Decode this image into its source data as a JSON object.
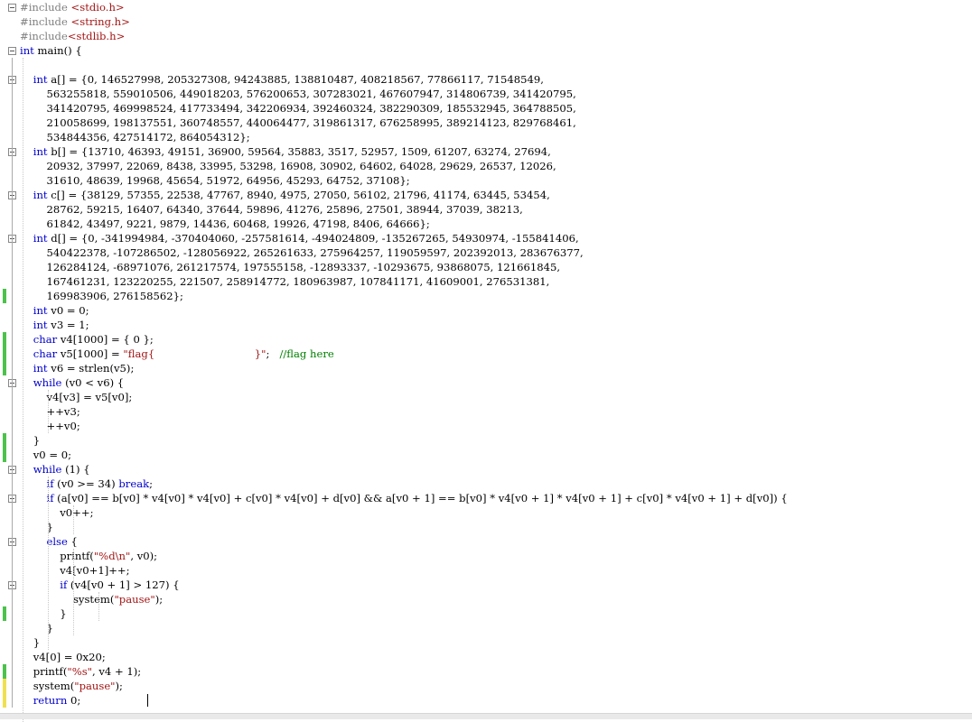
{
  "editor": {
    "lines": [
      {
        "text": "#include <stdio.h>",
        "kind": "include",
        "fold": true,
        "bar": null
      },
      {
        "text": "#include <string.h>",
        "kind": "include",
        "fold": false,
        "bar": null
      },
      {
        "text": "#include<stdlib.h>",
        "kind": "include",
        "fold": false,
        "bar": null
      },
      {
        "text": "int main() {",
        "kind": "code",
        "fold": true,
        "bar": null
      },
      {
        "text": "",
        "kind": "code",
        "fold": false,
        "bar": null
      },
      {
        "text": "    int a[] = {0, 146527998, 205327308, 94243885, 138810487, 408218567, 77866117, 71548549,",
        "kind": "code",
        "fold": true,
        "bar": null
      },
      {
        "text": "        563255818, 559010506, 449018203, 576200653, 307283021, 467607947, 314806739, 341420795,",
        "kind": "code",
        "fold": false,
        "bar": null
      },
      {
        "text": "        341420795, 469998524, 417733494, 342206934, 392460324, 382290309, 185532945, 364788505,",
        "kind": "code",
        "fold": false,
        "bar": null
      },
      {
        "text": "        210058699, 198137551, 360748557, 440064477, 319861317, 676258995, 389214123, 829768461,",
        "kind": "code",
        "fold": false,
        "bar": null
      },
      {
        "text": "        534844356, 427514172, 864054312};",
        "kind": "code",
        "fold": false,
        "bar": null
      },
      {
        "text": "    int b[] = {13710, 46393, 49151, 36900, 59564, 35883, 3517, 52957, 1509, 61207, 63274, 27694,",
        "kind": "code",
        "fold": true,
        "bar": null
      },
      {
        "text": "        20932, 37997, 22069, 8438, 33995, 53298, 16908, 30902, 64602, 64028, 29629, 26537, 12026,",
        "kind": "code",
        "fold": false,
        "bar": null
      },
      {
        "text": "        31610, 48639, 19968, 45654, 51972, 64956, 45293, 64752, 37108};",
        "kind": "code",
        "fold": false,
        "bar": null
      },
      {
        "text": "    int c[] = {38129, 57355, 22538, 47767, 8940, 4975, 27050, 56102, 21796, 41174, 63445, 53454,",
        "kind": "code",
        "fold": true,
        "bar": null
      },
      {
        "text": "        28762, 59215, 16407, 64340, 37644, 59896, 41276, 25896, 27501, 38944, 37039, 38213,",
        "kind": "code",
        "fold": false,
        "bar": null
      },
      {
        "text": "        61842, 43497, 9221, 9879, 14436, 60468, 19926, 47198, 8406, 64666};",
        "kind": "code",
        "fold": false,
        "bar": null
      },
      {
        "text": "    int d[] = {0, -341994984, -370404060, -257581614, -494024809, -135267265, 54930974, -155841406,",
        "kind": "code",
        "fold": true,
        "bar": null
      },
      {
        "text": "        540422378, -107286502, -128056922, 265261633, 275964257, 119059597, 202392013, 283676377,",
        "kind": "code",
        "fold": false,
        "bar": null
      },
      {
        "text": "        126284124, -68971076, 261217574, 197555158, -12893337, -10293675, 93868075, 121661845,",
        "kind": "code",
        "fold": false,
        "bar": null
      },
      {
        "text": "        167461231, 123220255, 221507, 258914772, 180963987, 107841171, 41609001, 276531381,",
        "kind": "code",
        "fold": false,
        "bar": null
      },
      {
        "text": "        169983906, 276158562};",
        "kind": "code",
        "fold": false,
        "bar": "green"
      },
      {
        "text": "    int v0 = 0;",
        "kind": "code",
        "fold": false,
        "bar": null
      },
      {
        "text": "    int v3 = 1;",
        "kind": "code",
        "fold": false,
        "bar": null
      },
      {
        "text": "    char v4[1000] = { 0 };",
        "kind": "code",
        "fold": false,
        "bar": "green"
      },
      {
        "text": "    char v5[1000] = \"flag{                              }\";   //flag here",
        "kind": "code",
        "fold": false,
        "bar": "green"
      },
      {
        "text": "    int v6 = strlen(v5);",
        "kind": "code",
        "fold": false,
        "bar": "green"
      },
      {
        "text": "    while (v0 < v6) {",
        "kind": "code",
        "fold": true,
        "bar": null
      },
      {
        "text": "        v4[v3] = v5[v0];",
        "kind": "code",
        "fold": false,
        "bar": null
      },
      {
        "text": "        ++v3;",
        "kind": "code",
        "fold": false,
        "bar": null
      },
      {
        "text": "        ++v0;",
        "kind": "code",
        "fold": false,
        "bar": null
      },
      {
        "text": "    }",
        "kind": "code",
        "fold": false,
        "bar": "green"
      },
      {
        "text": "    v0 = 0;",
        "kind": "code",
        "fold": false,
        "bar": "green"
      },
      {
        "text": "    while (1) {",
        "kind": "code",
        "fold": true,
        "bar": null
      },
      {
        "text": "        if (v0 >= 34) break;",
        "kind": "code",
        "fold": false,
        "bar": null
      },
      {
        "text": "        if (a[v0] == b[v0] * v4[v0] * v4[v0] + c[v0] * v4[v0] + d[v0] && a[v0 + 1] == b[v0] * v4[v0 + 1] * v4[v0 + 1] + c[v0] * v4[v0 + 1] + d[v0]) {",
        "kind": "code",
        "fold": true,
        "bar": null
      },
      {
        "text": "            v0++;",
        "kind": "code",
        "fold": false,
        "bar": null
      },
      {
        "text": "        }",
        "kind": "code",
        "fold": false,
        "bar": null
      },
      {
        "text": "        else {",
        "kind": "code",
        "fold": true,
        "bar": null
      },
      {
        "text": "            printf(\"%d\\n\", v0);",
        "kind": "code",
        "fold": false,
        "bar": null
      },
      {
        "text": "            v4[v0+1]++;",
        "kind": "code",
        "fold": false,
        "bar": null
      },
      {
        "text": "            if (v4[v0 + 1] > 127) {",
        "kind": "code",
        "fold": true,
        "bar": null
      },
      {
        "text": "                system(\"pause\");",
        "kind": "code",
        "fold": false,
        "bar": null
      },
      {
        "text": "            }",
        "kind": "code",
        "fold": false,
        "bar": "green"
      },
      {
        "text": "        }",
        "kind": "code",
        "fold": false,
        "bar": null
      },
      {
        "text": "    }",
        "kind": "code",
        "fold": false,
        "bar": null
      },
      {
        "text": "    v4[0] = 0x20;",
        "kind": "code",
        "fold": false,
        "bar": null
      },
      {
        "text": "    printf(\"%s\", v4 + 1);",
        "kind": "code",
        "fold": false,
        "bar": "green"
      },
      {
        "text": "    system(\"pause\");",
        "kind": "code",
        "fold": false,
        "bar": "yellow"
      },
      {
        "text": "    return 0;",
        "kind": "code",
        "fold": false,
        "bar": "yellow"
      }
    ],
    "colors": {
      "keyword": "#0000cc",
      "string": "#a31515",
      "comment": "#008000",
      "preprocessor": "#808080",
      "bar_green": "#4cc24c",
      "bar_yellow": "#f0e050"
    }
  }
}
